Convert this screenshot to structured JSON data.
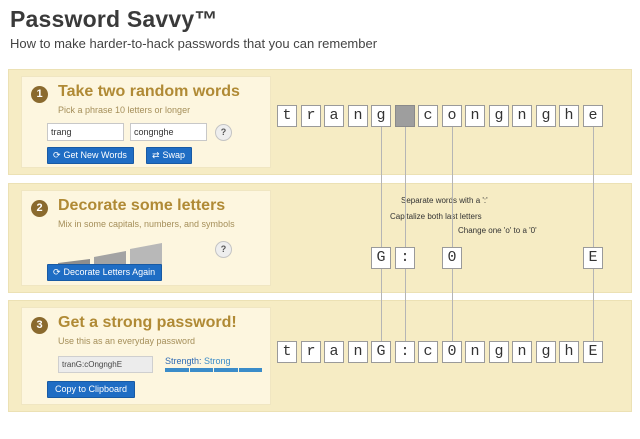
{
  "app": {
    "title": "Password Savvy™",
    "subtitle": "How to make harder-to-hack passwords that you can remember"
  },
  "step1": {
    "num": "1",
    "title": "Take two random words",
    "hint": "Pick a phrase 10 letters or longer",
    "word1": "trang",
    "word2": "congnghe",
    "help": "?",
    "new_words_label": "Get New Words",
    "swap_label": "Swap"
  },
  "step2": {
    "num": "2",
    "title": "Decorate some letters",
    "hint": "Mix in some capitals, numbers, and symbols",
    "help": "?",
    "decorate_label": "Decorate Letters Again"
  },
  "step3": {
    "num": "3",
    "title": "Get a strong password!",
    "hint": "Use this as an everyday password",
    "password": "tranG:cOngnghE",
    "strength_key": "Strength:",
    "strength_value": "Strong",
    "copy_label": "Copy to Clipboard"
  },
  "diagram": {
    "top_row": [
      "t",
      "r",
      "a",
      "n",
      "g",
      "",
      "c",
      "o",
      "n",
      "g",
      "n",
      "g",
      "h",
      "e"
    ],
    "changed": [
      "G",
      ":",
      "0",
      "E"
    ],
    "bottom_row": [
      "t",
      "r",
      "a",
      "n",
      "G",
      ":",
      "c",
      "0",
      "n",
      "g",
      "n",
      "g",
      "h",
      "E"
    ],
    "notes": {
      "separator": "Separate words with a ':'",
      "capitalize": "Capitalize both last letters",
      "change_o": "Change one 'o' to a '0'"
    }
  },
  "colors": {
    "band": "#f6ecc4",
    "card": "#fdf6df",
    "step_title": "#b08a35",
    "button": "#1f6dc4",
    "strength": "#3b8cc9"
  },
  "icons": {
    "refresh": "refresh-icon",
    "swap": "swap-icon"
  }
}
